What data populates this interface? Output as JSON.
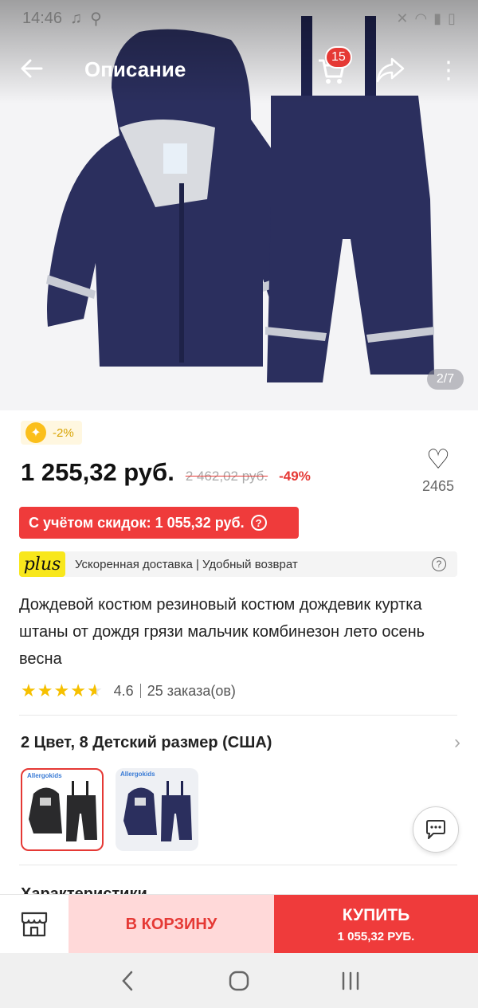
{
  "status_bar": {
    "time": "14:46"
  },
  "app_bar": {
    "title": "Описание",
    "cart_count": "15"
  },
  "gallery": {
    "counter": "2/7"
  },
  "promo": {
    "label": "-2%"
  },
  "price": {
    "current": "1 255,32 руб.",
    "old": "2 462,02 руб.",
    "discount": "-49%"
  },
  "wishlist": {
    "count": "2465"
  },
  "discount_bar": {
    "label": "С учётом скидок: 1 055,32 руб."
  },
  "plus": {
    "logo": "plus",
    "text": "Ускоренная доставка | Удобный возврат"
  },
  "product": {
    "title": "Дождевой костюм резиновый костюм дождевик куртка штаны от дождя грязи мальчик комбинезон лето осень весна"
  },
  "rating": {
    "value": "4.6",
    "orders": "25 заказа(ов)",
    "stars": 4.6
  },
  "variants": {
    "label": "2 Цвет, 8 Детский размер (США)",
    "thumb_logo": "Allergokids"
  },
  "characteristics": {
    "label": "Характеристики"
  },
  "actions": {
    "add_to_cart": "В КОРЗИНУ",
    "buy": "КУПИТЬ",
    "buy_price": "1 055,32 РУБ."
  },
  "colors": {
    "accent": "#ef3b3b",
    "cart_bg": "#ffd9d9",
    "star": "#f6c000",
    "plus_yellow": "#f8e71c"
  }
}
